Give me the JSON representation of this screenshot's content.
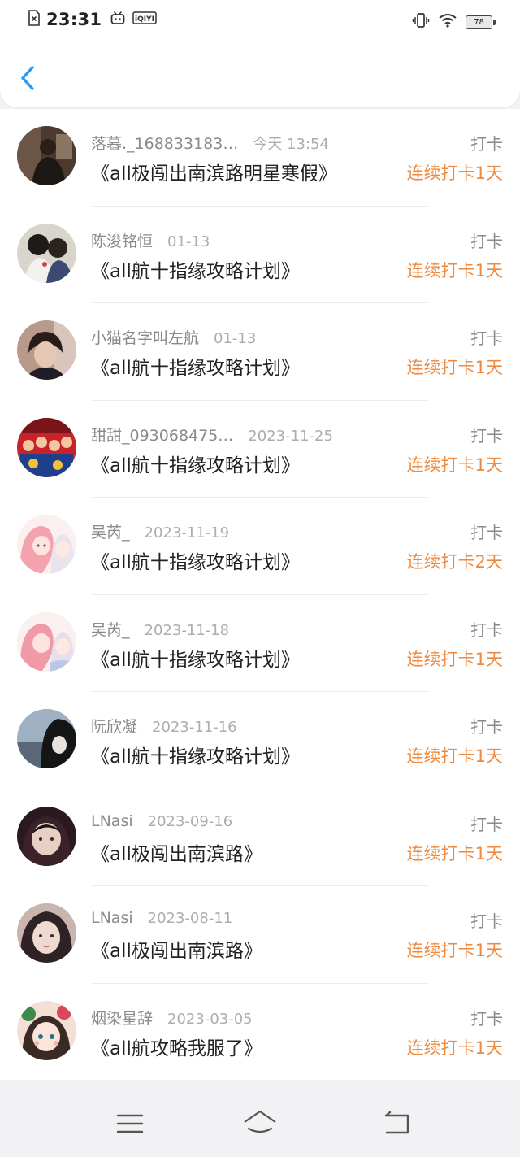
{
  "status_bar": {
    "time": "23:31",
    "qiyi_label": "iQIYI",
    "battery_level": "78"
  },
  "colors": {
    "accent_blue": "#2b9af3",
    "streak_orange": "#f08a3e",
    "text_primary": "#222222",
    "text_secondary": "#8a8a8a"
  },
  "entries": [
    {
      "user": "落暮._168833183…",
      "time": "今天 13:54",
      "plan": "《all极闯出南滨路明星寒假》",
      "action": "打卡",
      "streak": "连续打卡1天"
    },
    {
      "user": "陈浚铭恒",
      "time": "01-13",
      "plan": "《all航十指缘攻略计划》",
      "action": "打卡",
      "streak": "连续打卡1天"
    },
    {
      "user": "小猫名字叫左航",
      "time": "01-13",
      "plan": "《all航十指缘攻略计划》",
      "action": "打卡",
      "streak": "连续打卡1天"
    },
    {
      "user": "甜甜_093068475…",
      "time": "2023-11-25",
      "plan": "《all航十指缘攻略计划》",
      "action": "打卡",
      "streak": "连续打卡1天"
    },
    {
      "user": "吴芮_",
      "time": "2023-11-19",
      "plan": "《all航十指缘攻略计划》",
      "action": "打卡",
      "streak": "连续打卡2天"
    },
    {
      "user": "吴芮_",
      "time": "2023-11-18",
      "plan": "《all航十指缘攻略计划》",
      "action": "打卡",
      "streak": "连续打卡1天"
    },
    {
      "user": "阮欣凝",
      "time": "2023-11-16",
      "plan": "《all航十指缘攻略计划》",
      "action": "打卡",
      "streak": "连续打卡1天"
    },
    {
      "user": "LNasi",
      "time": "2023-09-16",
      "plan": "《all极闯出南滨路》",
      "action": "打卡",
      "streak": "连续打卡1天"
    },
    {
      "user": "LNasi",
      "time": "2023-08-11",
      "plan": "《all极闯出南滨路》",
      "action": "打卡",
      "streak": "连续打卡1天"
    },
    {
      "user": "烟染星辞",
      "time": "2023-03-05",
      "plan": "《all航攻略我服了》",
      "action": "打卡",
      "streak": "连续打卡1天"
    }
  ],
  "nav_bar": {
    "icons": [
      "menu-icon",
      "home-icon",
      "back-icon"
    ]
  }
}
